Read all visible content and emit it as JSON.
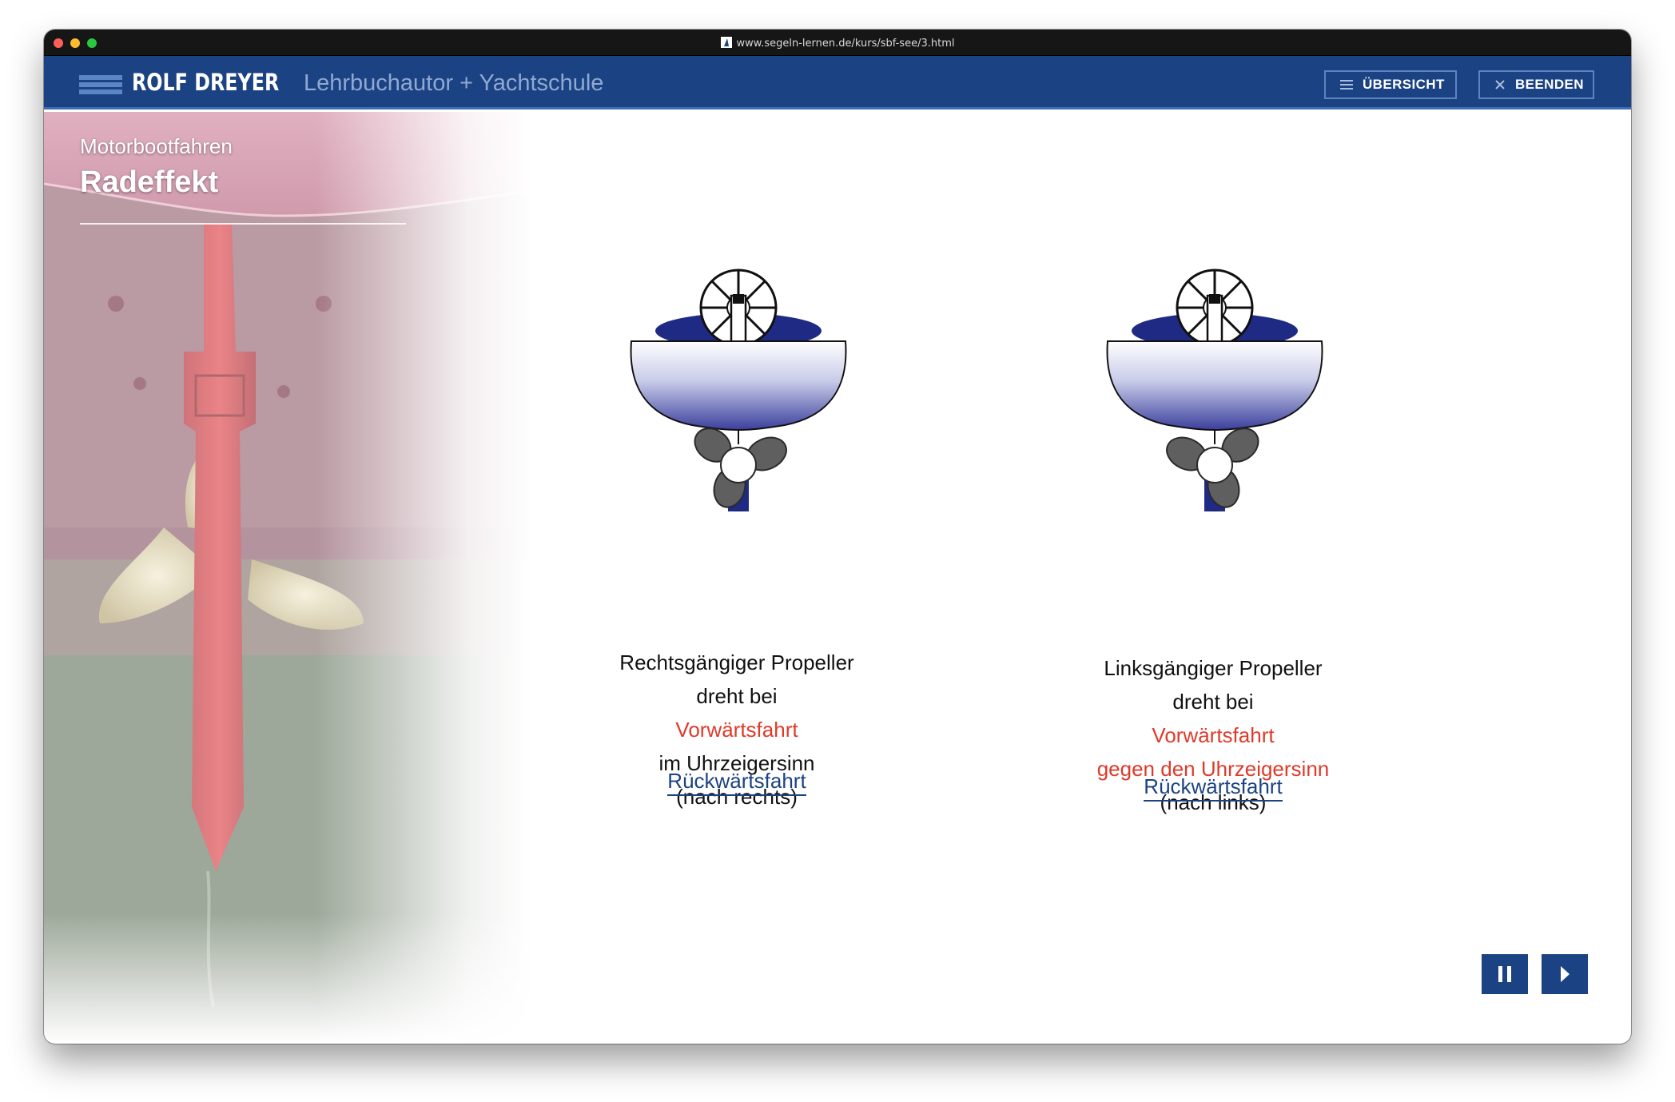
{
  "browser": {
    "url": "www.segeln-lernen.de/kurs/sbf-see/3.html"
  },
  "header": {
    "brand": "ROLF DREYER",
    "tagline": "Lehrbuchautor + Yachtschule",
    "overview_label": "ÜBERSICHT",
    "end_label": "BEENDEN"
  },
  "sidebar": {
    "section": "Motorbootfahren",
    "title": "Radeffekt"
  },
  "panels": [
    {
      "line1": "Rechtsgängiger Propeller",
      "line2": "dreht bei",
      "line3": "Vorwärtsfahrt",
      "line4": "im Uhrzeigersinn",
      "line5": "(nach rechts)",
      "link": "Rückwärtsfahrt"
    },
    {
      "line1": "Linksgängiger Propeller",
      "line2": "dreht bei",
      "line3": "Vorwärtsfahrt",
      "line4": "gegen den Uhrzeigersinn",
      "line5": "(nach links)",
      "link": "Rückwärtsfahrt"
    }
  ],
  "controls": {
    "pause_icon": "pause-icon",
    "next_icon": "next-icon"
  },
  "colors": {
    "brand_blue": "#1b4283",
    "accent_red": "#df3a2a",
    "hull_navy": "#1f2a84"
  }
}
